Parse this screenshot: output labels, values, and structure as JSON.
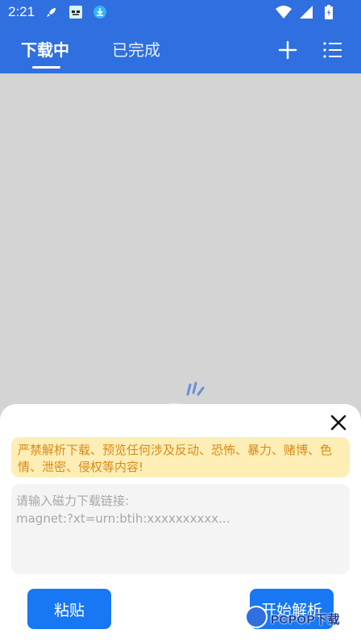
{
  "status_bar": {
    "time": "2:21",
    "left_icons": [
      "rocket-icon",
      "app-icon",
      "download-icon"
    ],
    "right_icons": [
      "wifi-icon",
      "signal-icon",
      "battery-icon"
    ]
  },
  "top_bar": {
    "tabs": [
      {
        "label": "下载中",
        "active": true
      },
      {
        "label": "已完成",
        "active": false
      }
    ],
    "actions": [
      "add-icon",
      "list-icon"
    ],
    "color": "#2f6fe0"
  },
  "sheet": {
    "warning": "严禁解析下载、预览任何涉及反动、恐怖、暴力、赌博、色情、泄密、侵权等内容!",
    "input_placeholder": "请输入磁力下载链接:\nmagnet:?xt=urn:btih:xxxxxxxxxx...",
    "input_value": "",
    "paste_label": "粘贴",
    "parse_label": "开始解析"
  },
  "watermark": {
    "text": "PCPOP下载"
  }
}
